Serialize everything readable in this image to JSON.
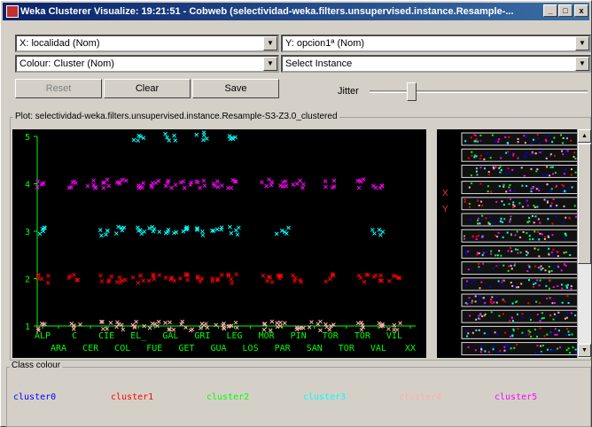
{
  "window": {
    "title": "Weka Clusterer Visualize: 19:21:51 - Cobweb (selectividad-weka.filters.unsupervised.instance.Resample-...",
    "controls": {
      "minimize": "_",
      "maximize": "□",
      "close": "x"
    }
  },
  "x_select": {
    "value": "X: localidad (Nom)"
  },
  "y_select": {
    "value": "Y: opcion1ª (Nom)"
  },
  "colour_select": {
    "value": "Colour: Cluster (Nom)"
  },
  "instance_select": {
    "value": "Select Instance"
  },
  "buttons": {
    "reset": "Reset",
    "clear": "Clear",
    "save": "Save"
  },
  "jitter": {
    "label": "Jitter",
    "level_fraction": 0.18
  },
  "plot": {
    "caption": "Plot: selectividad-weka.filters.unsupervised.instance.Resample-S3-Z3.0_clustered",
    "background": "#000000",
    "axis_color": "#00ff00"
  },
  "attr_panel": {
    "x_marker": "X",
    "y_marker": "Y"
  },
  "class_colour": {
    "caption": "Class colour",
    "clusters": [
      {
        "name": "cluster0",
        "color": "#0000ff"
      },
      {
        "name": "cluster1",
        "color": "#ff0000"
      },
      {
        "name": "cluster2",
        "color": "#00ff00"
      },
      {
        "name": "cluster3",
        "color": "#00ffff"
      },
      {
        "name": "cluster4",
        "color": "#ffafaf"
      },
      {
        "name": "cluster5",
        "color": "#ff00ff"
      }
    ]
  },
  "chart_data": {
    "type": "scatter",
    "x_categories_row1": [
      "ALP",
      "C",
      "CIE",
      "EL_",
      "GAL",
      "GRI",
      "LEG",
      "MOR",
      "PIN",
      "TOR",
      "TOR",
      "VIL"
    ],
    "x_categories_row2": [
      "ARA",
      "CER",
      "COL",
      "FUE",
      "GET",
      "GUA",
      "LOS",
      "PAR",
      "SAN",
      "TOR",
      "VAL",
      "XX"
    ],
    "y_ticks": [
      "1",
      "2",
      "3",
      "4",
      "5"
    ],
    "ylim": [
      1,
      5
    ],
    "points": [
      {
        "x": 0,
        "y": 4,
        "c": 5
      },
      {
        "x": 0,
        "y": 3,
        "c": 3
      },
      {
        "x": 0,
        "y": 2,
        "c": 1
      },
      {
        "x": 0,
        "y": 1,
        "c": 4
      },
      {
        "x": 2,
        "y": 4,
        "c": 5
      },
      {
        "x": 2,
        "y": 2,
        "c": 1
      },
      {
        "x": 2,
        "y": 1,
        "c": 4
      },
      {
        "x": 3,
        "y": 4,
        "c": 5
      },
      {
        "x": 4,
        "y": 4,
        "c": 5
      },
      {
        "x": 4,
        "y": 3,
        "c": 3
      },
      {
        "x": 4,
        "y": 2,
        "c": 1
      },
      {
        "x": 4,
        "y": 1,
        "c": 4
      },
      {
        "x": 5,
        "y": 4,
        "c": 5
      },
      {
        "x": 5,
        "y": 3,
        "c": 3
      },
      {
        "x": 5,
        "y": 2,
        "c": 1
      },
      {
        "x": 5,
        "y": 1,
        "c": 4
      },
      {
        "x": 6,
        "y": 5,
        "c": 3
      },
      {
        "x": 6,
        "y": 4,
        "c": 5
      },
      {
        "x": 6,
        "y": 3,
        "c": 3
      },
      {
        "x": 6,
        "y": 2,
        "c": 1
      },
      {
        "x": 6,
        "y": 1,
        "c": 4
      },
      {
        "x": 7,
        "y": 4,
        "c": 5
      },
      {
        "x": 7,
        "y": 3,
        "c": 3
      },
      {
        "x": 7,
        "y": 2,
        "c": 1
      },
      {
        "x": 7,
        "y": 1,
        "c": 4
      },
      {
        "x": 8,
        "y": 5,
        "c": 3
      },
      {
        "x": 8,
        "y": 4,
        "c": 5
      },
      {
        "x": 8,
        "y": 3,
        "c": 3
      },
      {
        "x": 8,
        "y": 2,
        "c": 1
      },
      {
        "x": 8,
        "y": 1,
        "c": 4
      },
      {
        "x": 9,
        "y": 4,
        "c": 5
      },
      {
        "x": 9,
        "y": 3,
        "c": 3
      },
      {
        "x": 9,
        "y": 2,
        "c": 1
      },
      {
        "x": 9,
        "y": 1,
        "c": 4
      },
      {
        "x": 10,
        "y": 5,
        "c": 3
      },
      {
        "x": 10,
        "y": 4,
        "c": 5
      },
      {
        "x": 10,
        "y": 3,
        "c": 3
      },
      {
        "x": 10,
        "y": 2,
        "c": 1
      },
      {
        "x": 10,
        "y": 1,
        "c": 4
      },
      {
        "x": 11,
        "y": 4,
        "c": 5
      },
      {
        "x": 11,
        "y": 3,
        "c": 3
      },
      {
        "x": 11,
        "y": 2,
        "c": 1
      },
      {
        "x": 11,
        "y": 1,
        "c": 4
      },
      {
        "x": 12,
        "y": 5,
        "c": 3
      },
      {
        "x": 12,
        "y": 4,
        "c": 5
      },
      {
        "x": 12,
        "y": 3,
        "c": 3
      },
      {
        "x": 12,
        "y": 2,
        "c": 1
      },
      {
        "x": 12,
        "y": 1,
        "c": 4
      },
      {
        "x": 14,
        "y": 4,
        "c": 5
      },
      {
        "x": 14,
        "y": 2,
        "c": 1
      },
      {
        "x": 14,
        "y": 1,
        "c": 4
      },
      {
        "x": 15,
        "y": 4,
        "c": 5
      },
      {
        "x": 15,
        "y": 3,
        "c": 3
      },
      {
        "x": 15,
        "y": 2,
        "c": 1
      },
      {
        "x": 15,
        "y": 1,
        "c": 4
      },
      {
        "x": 16,
        "y": 4,
        "c": 5
      },
      {
        "x": 16,
        "y": 2,
        "c": 1
      },
      {
        "x": 16,
        "y": 1,
        "c": 4
      },
      {
        "x": 17,
        "y": 1,
        "c": 4
      },
      {
        "x": 18,
        "y": 4,
        "c": 5
      },
      {
        "x": 18,
        "y": 2,
        "c": 1
      },
      {
        "x": 18,
        "y": 1,
        "c": 4
      },
      {
        "x": 20,
        "y": 4,
        "c": 5
      },
      {
        "x": 20,
        "y": 2,
        "c": 1
      },
      {
        "x": 20,
        "y": 1,
        "c": 4
      },
      {
        "x": 21,
        "y": 4,
        "c": 5
      },
      {
        "x": 21,
        "y": 3,
        "c": 3
      },
      {
        "x": 21,
        "y": 2,
        "c": 1
      },
      {
        "x": 21,
        "y": 1,
        "c": 4
      },
      {
        "x": 22,
        "y": 2,
        "c": 1
      },
      {
        "x": 22,
        "y": 1,
        "c": 4
      }
    ]
  }
}
